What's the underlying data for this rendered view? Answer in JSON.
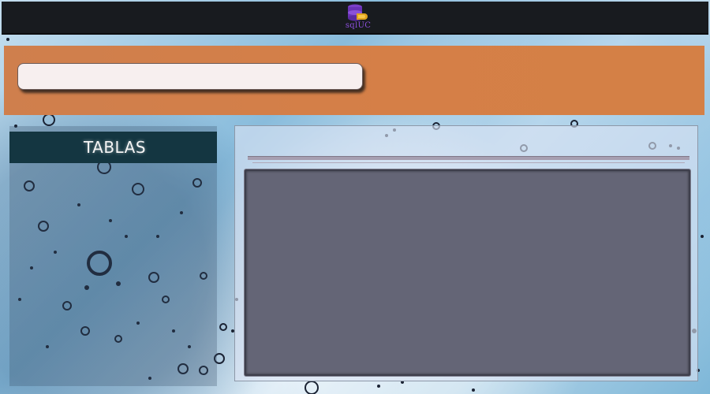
{
  "app": {
    "logo_text": "sqlUC",
    "logo_icon": "database-icon",
    "logo_color": "#8e4fe0",
    "topbar_color": "#181b1f"
  },
  "header": {
    "banner_color": "#d27f48",
    "search": {
      "value": "",
      "placeholder": ""
    }
  },
  "sidebar": {
    "title": "TABLAS",
    "header_color": "#143641"
  },
  "main": {
    "results_color": "#646576"
  }
}
